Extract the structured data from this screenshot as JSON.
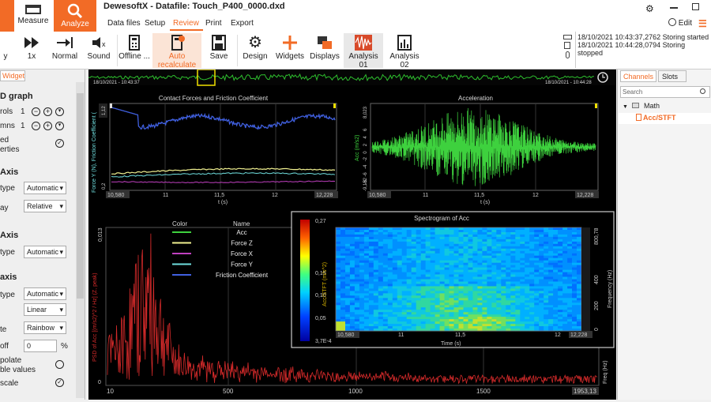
{
  "app": {
    "title": "DewesoftX - Datafile: Touch_P400_0000.dxd"
  },
  "modes": [
    {
      "label": "Measure"
    },
    {
      "label": "Analyze"
    }
  ],
  "menu": [
    "Data files",
    "Setup",
    "Review",
    "Print",
    "Export"
  ],
  "menu_active": "Review",
  "topright": {
    "edit": "Edit"
  },
  "ribbon": [
    {
      "label": "y"
    },
    {
      "label": "1x"
    },
    {
      "label": "Normal"
    },
    {
      "label": "Sound"
    },
    {
      "label": "Offline ..."
    },
    {
      "label": "Auto recalculate"
    },
    {
      "label": "Save"
    },
    {
      "label": "Design"
    },
    {
      "label": "Widgets"
    },
    {
      "label": "Displays"
    },
    {
      "label": "Analysis 01"
    },
    {
      "label": "Analysis 02"
    }
  ],
  "log": [
    "18/10/2021 10:43:37,2762 Storing started",
    "18/10/2021 10:44:28,0794 Storing stopped"
  ],
  "left": {
    "tab": "Widget",
    "sec1": "D graph",
    "rows1": [
      {
        "l": "rols",
        "v": "1"
      },
      {
        "l": "mns",
        "v": "1"
      }
    ],
    "check1a": "ed",
    "check1b": "erties",
    "sec2": "Axis",
    "type_l": "type",
    "type_v": "Automatic",
    "lay_v": "Relative",
    "lay_l": "ay",
    "sec3": "Axis",
    "type3_v": "Automatic",
    "sec4": "axis",
    "type4_v": "Automatic",
    "lin_v": "Linear",
    "rain_v": "Rainbow",
    "rain_l": "te",
    "off_l": "off",
    "off_v": "0",
    "pct": "%",
    "interp1": "polate",
    "interp2": "ble values",
    "scale": "scale"
  },
  "time": {
    "start": "18/10/2021 - 10:43:37",
    "end": "18/10/2021 - 10:44:28"
  },
  "graph1": {
    "title": "Contact Forces and Friction Coefficient",
    "ylabel": "Force Y (N), Friction Coefficient (",
    "ytop": "1,12",
    "ybot": "0,2",
    "xticks": [
      "10,580",
      "11",
      "11,5",
      "12",
      "12,228"
    ],
    "xlabel": "t (s)"
  },
  "graph2": {
    "title": "Acceleration",
    "ylabel": "Acc (m/s2)",
    "ytop": "8,023",
    "ybot": "-9,152",
    "yticks": [
      "6",
      "4",
      "2",
      "0",
      "-2",
      "-4",
      "-6",
      "-8"
    ],
    "xticks": [
      "10,580",
      "11",
      "11,5",
      "12",
      "12,228"
    ],
    "xlabel": "t (s)"
  },
  "legend": {
    "h_color": "Color",
    "h_name": "Name",
    "items": [
      {
        "name": "Acc",
        "color": "#3ed13e"
      },
      {
        "name": "Force Z",
        "color": "#f0f090"
      },
      {
        "name": "Force X",
        "color": "#c040c0"
      },
      {
        "name": "Force Y",
        "color": "#70e0e0"
      },
      {
        "name": "Friction Coefficient",
        "color": "#4060e0"
      }
    ]
  },
  "fft": {
    "ylabel": "PSD of Acc [(m/s2)^2 / Hz] (Z, peak)",
    "ytop": "0,013",
    "ybot": "0",
    "xticks": [
      "10",
      "500",
      "1000",
      "1500",
      "1953,13"
    ],
    "xlabel": "Freq (Hz)"
  },
  "spectrogram": {
    "title": "Spectrogram of Acc",
    "cbar_label": "Acc/STFT (m/s^2)",
    "cbar_ticks": [
      "0,27",
      "0,15",
      "0,10",
      "0,05",
      "3,7E-4"
    ],
    "xticks": [
      "10,580",
      "11",
      "11,5",
      "12",
      "12,228"
    ],
    "xlabel": "Time (s)",
    "ylabel": "Frequency (Hz)",
    "yticks": [
      "800,78",
      "400",
      "200",
      "0"
    ]
  },
  "right": {
    "tabs": [
      "Channels",
      "Slots"
    ],
    "search": "Search",
    "group": "Math",
    "item": "Acc/STFT"
  },
  "colors": {
    "accent": "#f26b26",
    "green": "#3ed13e",
    "red": "#d42a2a"
  }
}
